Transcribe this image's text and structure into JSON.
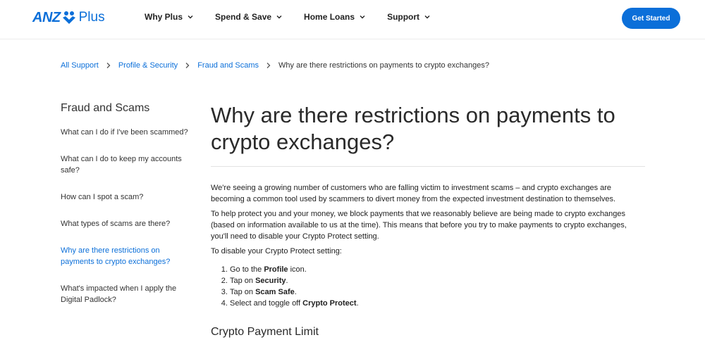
{
  "header": {
    "logo_brand": "ANZ",
    "logo_suffix": "Plus",
    "nav": [
      {
        "label": "Why Plus"
      },
      {
        "label": "Spend & Save"
      },
      {
        "label": "Home Loans"
      },
      {
        "label": "Support"
      }
    ],
    "cta_label": "Get Started"
  },
  "breadcrumb": {
    "items": [
      "All Support",
      "Profile & Security",
      "Fraud and Scams"
    ],
    "current": "Why are there restrictions on payments to crypto exchanges?"
  },
  "sidebar": {
    "title": "Fraud and Scams",
    "items": [
      {
        "label": "What can I do if I've been scammed?"
      },
      {
        "label": "What can I do to keep my accounts safe?"
      },
      {
        "label": "How can I spot a scam?"
      },
      {
        "label": "What types of scams are there?"
      },
      {
        "label": "Why are there restrictions on payments to crypto exchanges?"
      },
      {
        "label": "What's impacted when I apply the Digital Padlock?"
      }
    ]
  },
  "article": {
    "title": "Why are there restrictions on payments to crypto exchanges?",
    "paragraphs": [
      "We're seeing a growing number of customers who are falling victim to investment scams – and crypto exchanges are becoming a common tool used by scammers to divert money from the expected investment destination to themselves.",
      "To help protect you and your money, we block payments that we reasonably believe are being made to crypto exchanges (based on information available to us at the time). This means that before you try to make payments to crypto exchanges, you'll need to disable your Crypto Protect setting.",
      "To disable your Crypto Protect setting:"
    ],
    "steps": [
      {
        "pre": "Go to the ",
        "bold": "Profile",
        "post": " icon."
      },
      {
        "pre": "Tap on ",
        "bold": "Security",
        "post": "."
      },
      {
        "pre": "Tap on ",
        "bold": "Scam Safe",
        "post": "."
      },
      {
        "pre": "Select and toggle off ",
        "bold": "Crypto Protect",
        "post": "."
      }
    ],
    "section_title": "Crypto Payment Limit"
  }
}
